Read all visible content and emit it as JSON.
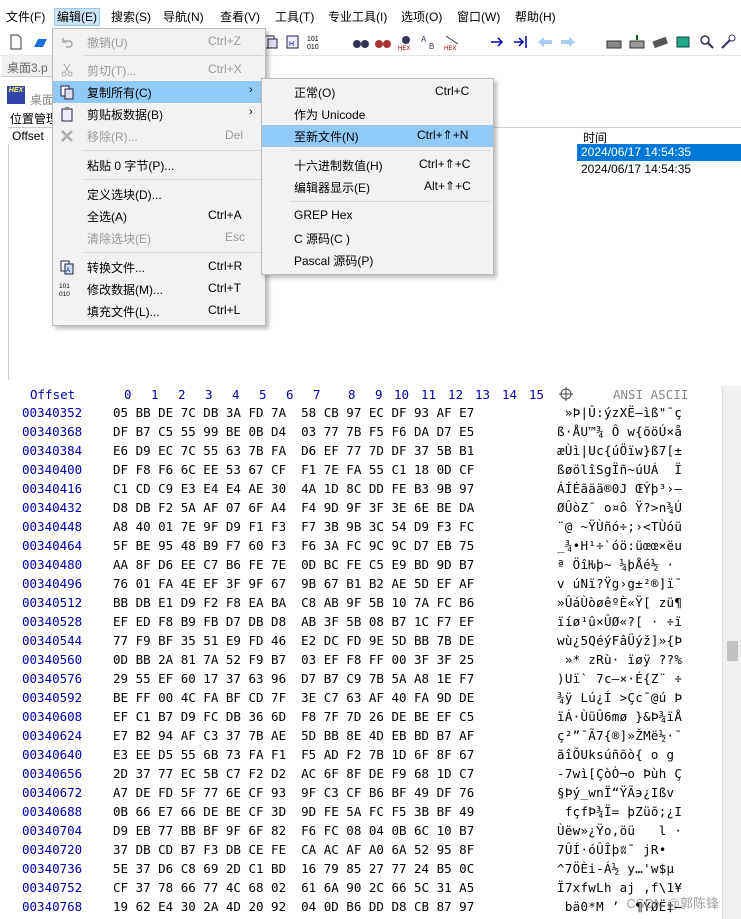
{
  "menubar": {
    "items": [
      {
        "label": "文件(F)"
      },
      {
        "label": "编辑(E)"
      },
      {
        "label": "搜索(S)"
      },
      {
        "label": "导航(N)"
      },
      {
        "label": "查看(V)"
      },
      {
        "label": "工具(T)"
      },
      {
        "label": "专业工具(I)"
      },
      {
        "label": "选项(O)"
      },
      {
        "label": "窗口(W)"
      },
      {
        "label": "帮助(H)"
      }
    ]
  },
  "file_tab": {
    "label": "桌面3.p"
  },
  "sub_window": {
    "title": "桌面"
  },
  "path_label": "位置管理",
  "file_list": {
    "headers": {
      "offset": "Offset",
      "time": "时间"
    },
    "rows": [
      {
        "time": "2024/06/17   14:54:35",
        "selected": true
      },
      {
        "time": "2024/06/17   14:54:35",
        "selected": false
      }
    ]
  },
  "edit_menu": {
    "items": [
      {
        "label": "撤销(U)",
        "shortcut": "Ctrl+Z",
        "disabled": true,
        "icon": "undo-icon"
      },
      {
        "label": "剪切(T)...",
        "shortcut": "Ctrl+X",
        "disabled": true,
        "icon": "scissors-icon"
      },
      {
        "label": "复制所有(C)",
        "shortcut": "",
        "disabled": false,
        "icon": "copy-icon",
        "submenu": true,
        "highlighted": true
      },
      {
        "label": "剪贴板数据(B)",
        "shortcut": "",
        "disabled": false,
        "icon": "clipboard-icon",
        "submenu": true
      },
      {
        "label": "移除(R)...",
        "shortcut": "Del",
        "disabled": true,
        "icon": "delete-x-icon"
      },
      {
        "label": "粘贴 0 字节(P)...",
        "shortcut": "",
        "disabled": false
      },
      {
        "label": "定义选块(D)...",
        "shortcut": "",
        "disabled": false
      },
      {
        "label": "全选(A)",
        "shortcut": "Ctrl+A",
        "disabled": false
      },
      {
        "label": "清除选块(E)",
        "shortcut": "Esc",
        "disabled": true
      },
      {
        "label": "转换文件...",
        "shortcut": "Ctrl+R",
        "disabled": false,
        "icon": "convert-icon"
      },
      {
        "label": "修改数据(M)...",
        "shortcut": "Ctrl+T",
        "disabled": false,
        "icon": "binary-icon"
      },
      {
        "label": "填充文件(L)...",
        "shortcut": "Ctrl+L",
        "disabled": false
      }
    ]
  },
  "copy_submenu": {
    "items": [
      {
        "label": "正常(O)",
        "shortcut": "Ctrl+C"
      },
      {
        "label": "作为 Unicode",
        "shortcut": ""
      },
      {
        "label": "至新文件(N)",
        "shortcut": "Ctrl+⇑+N",
        "highlighted": true
      },
      {
        "label": "十六进制数值(H)",
        "shortcut": "Ctrl+⇑+C"
      },
      {
        "label": "编辑器显示(E)",
        "shortcut": "Alt+⇑+C"
      },
      {
        "label": "GREP Hex",
        "shortcut": ""
      },
      {
        "label": "C 源码(C )",
        "shortcut": ""
      },
      {
        "label": "Pascal 源码(P)",
        "shortcut": ""
      }
    ]
  },
  "hex_header": {
    "offset": "Offset",
    "cols": [
      "0",
      "1",
      "2",
      "3",
      "4",
      "5",
      "6",
      "7",
      "8",
      "9",
      "10",
      "11",
      "12",
      "13",
      "14",
      "15"
    ],
    "encoding": "ANSI ASCII"
  },
  "hex_rows": [
    {
      "offset": "00340352",
      "bytes": "05 BB DE 7C DB 3A FD 7A  58 CB 97 EC DF 93 AF E7",
      "ascii": " »Þ|Û:ýzXË—ìß\"¯ç"
    },
    {
      "offset": "00340368",
      "bytes": "DF B7 C5 55 99 BE 0B D4  03 77 7B F5 F6 DA D7 E5",
      "ascii": "ß·ÅU™¾ Ô w{õöÚ×å"
    },
    {
      "offset": "00340384",
      "bytes": "E6 D9 EC 7C 55 63 7B FA  D6 EF 77 7D DF 37 5B B1",
      "ascii": "æÙì|Uc{úÖïw}ß7[±"
    },
    {
      "offset": "00340400",
      "bytes": "DF F8 F6 6C EE 53 67 CF  F1 7E FA 55 C1 18 0D CF",
      "ascii": "ßøölîSgÏñ~úUÁ  Ï"
    },
    {
      "offset": "00340416",
      "bytes": "C1 CD C9 E3 E4 E4 AE 30  4A 1D 8C DD FE B3 9B 97",
      "ascii": "ÁÍÉãää®0J ŒÝþ³›—"
    },
    {
      "offset": "00340432",
      "bytes": "D8 DB F2 5A AF 07 6F A4  F4 9D 9F 3F 3E 6E BE DA",
      "ascii": "ØÛòZ¯ o¤ô Ÿ?>n¾Ú"
    },
    {
      "offset": "00340448",
      "bytes": "A8 40 01 7E 9F D9 F1 F3  F7 3B 9B 3C 54 D9 F3 FC",
      "ascii": "¨@ ~ŸÙñó÷;›<TÙóü"
    },
    {
      "offset": "00340464",
      "bytes": "5F BE 95 48 B9 F7 60 F3  F6 3A FC 9C 9C D7 EB 75",
      "ascii": "_¾•H¹÷`óö:üœœ×ëu"
    },
    {
      "offset": "00340480",
      "bytes": "AA 8F D6 EE C7 B6 FE 7E  0D BC FE C5 E9 BD 9D B7",
      "ascii": "ª ÖîǶþ~ ¼þÅé½ ·"
    },
    {
      "offset": "00340496",
      "bytes": "76 01 FA 4E EF 3F 9F 67  9B 67 B1 B2 AE 5D EF AF",
      "ascii": "v úNï?Ÿg›g±²®]ï¯"
    },
    {
      "offset": "00340512",
      "bytes": "BB DB E1 D9 F2 F8 EA BA  C8 AB 9F 5B 10 7A FC B6",
      "ascii": "»ÛáÙòøêºÈ«Ÿ[ zü¶"
    },
    {
      "offset": "00340528",
      "bytes": "EF ED F8 B9 FB D7 DB D8  AB 3F 5B 08 B7 1C F7 EF",
      "ascii": "ïíø¹û×ÛØ«?[ · ÷ï"
    },
    {
      "offset": "00340544",
      "bytes": "77 F9 BF 35 51 E9 FD 46  E2 DC FD 9E 5D BB 7B DE",
      "ascii": "wù¿5QéýFâÜýž]»{Þ"
    },
    {
      "offset": "00340560",
      "bytes": "0D BB 2A 81 7A 52 F9 B7  03 EF F8 FF 00 3F 3F 25",
      "ascii": " »* zRù· ïøÿ ??%"
    },
    {
      "offset": "00340576",
      "bytes": "29 55 EF 60 17 37 63 96  D7 B7 C9 7B 5A A8 1E F7",
      "ascii": ")Uï` 7c–×·É{Z¨ ÷"
    },
    {
      "offset": "00340592",
      "bytes": "BE FF 00 4C FA BF CD 7F  3E C7 63 AF 40 FA 9D DE",
      "ascii": "¾ÿ Lú¿Í >Çc¯@ú Þ"
    },
    {
      "offset": "00340608",
      "bytes": "EF C1 B7 D9 FC DB 36 6D  F8 7F 7D 26 DE BE EF C5",
      "ascii": "ïÁ·ÙüÛ6mø }&Þ¾ïÅ"
    },
    {
      "offset": "00340624",
      "bytes": "E7 B2 94 AF C3 37 7B AE  5D BB 8E 4D EB BD B7 AF",
      "ascii": "ç²”¯Ã7{®]»ŽMë½·¯"
    },
    {
      "offset": "00340640",
      "bytes": "E3 EE D5 55 6B 73 FA F1  F5 AD F2 7B 1D 6F 8F 67",
      "ascii": "ãîÕUksúñõ­ò{ o g"
    },
    {
      "offset": "00340656",
      "bytes": "2D 37 77 EC 5B C7 F2 D2  AC 6F 8F DE F9 68 1D C7",
      "ascii": "-7wì[ÇòÒ¬o Þùh Ç"
    },
    {
      "offset": "00340672",
      "bytes": "A7 DE FD 5F 77 6E CF 93  9F C3 CF B6 BF 49 DF 76",
      "ascii": "§Þý_wnÏ“ŸÃ϶¿Ißv"
    },
    {
      "offset": "00340688",
      "bytes": "0B 66 E7 66 DE BE CF 3D  9D FE 5A FC F5 3B BF 49",
      "ascii": " fçfÞ¾Ï= þZüõ;¿I"
    },
    {
      "offset": "00340704",
      "bytes": "D9 EB 77 BB BF 9F 6F 82  F6 FC 08 04 0B 6C 10 B7",
      "ascii": "Ùëw»¿Ÿo‚öü   l ·"
    },
    {
      "offset": "00340720",
      "bytes": "37 DB CD B7 F3 DB CE FE  CA AC AF A0 6A 52 95 8F",
      "ascii": "7ÛÍ·óÛÎþʬ¯ jR• "
    },
    {
      "offset": "00340736",
      "bytes": "5E 37 D6 C8 69 2D C1 BD  16 79 85 27 77 24 B5 0C",
      "ascii": "^7ÖÈi-Á½ y…'w$µ "
    },
    {
      "offset": "00340752",
      "bytes": "CF 37 78 66 77 4C 68 02  61 6A 90 2C 66 5C 31 A5",
      "ascii": "Ï7xfwLh aj ,f\\1¥"
    },
    {
      "offset": "00340768",
      "bytes": "19 62 E4 30 2A 4D 20 92  04 0D B6 DD D8 CB 87 97",
      "ascii": " bä0*M ’  ¶ÝØË‡—"
    }
  ],
  "watermark": "CSDN @郭陈锋"
}
